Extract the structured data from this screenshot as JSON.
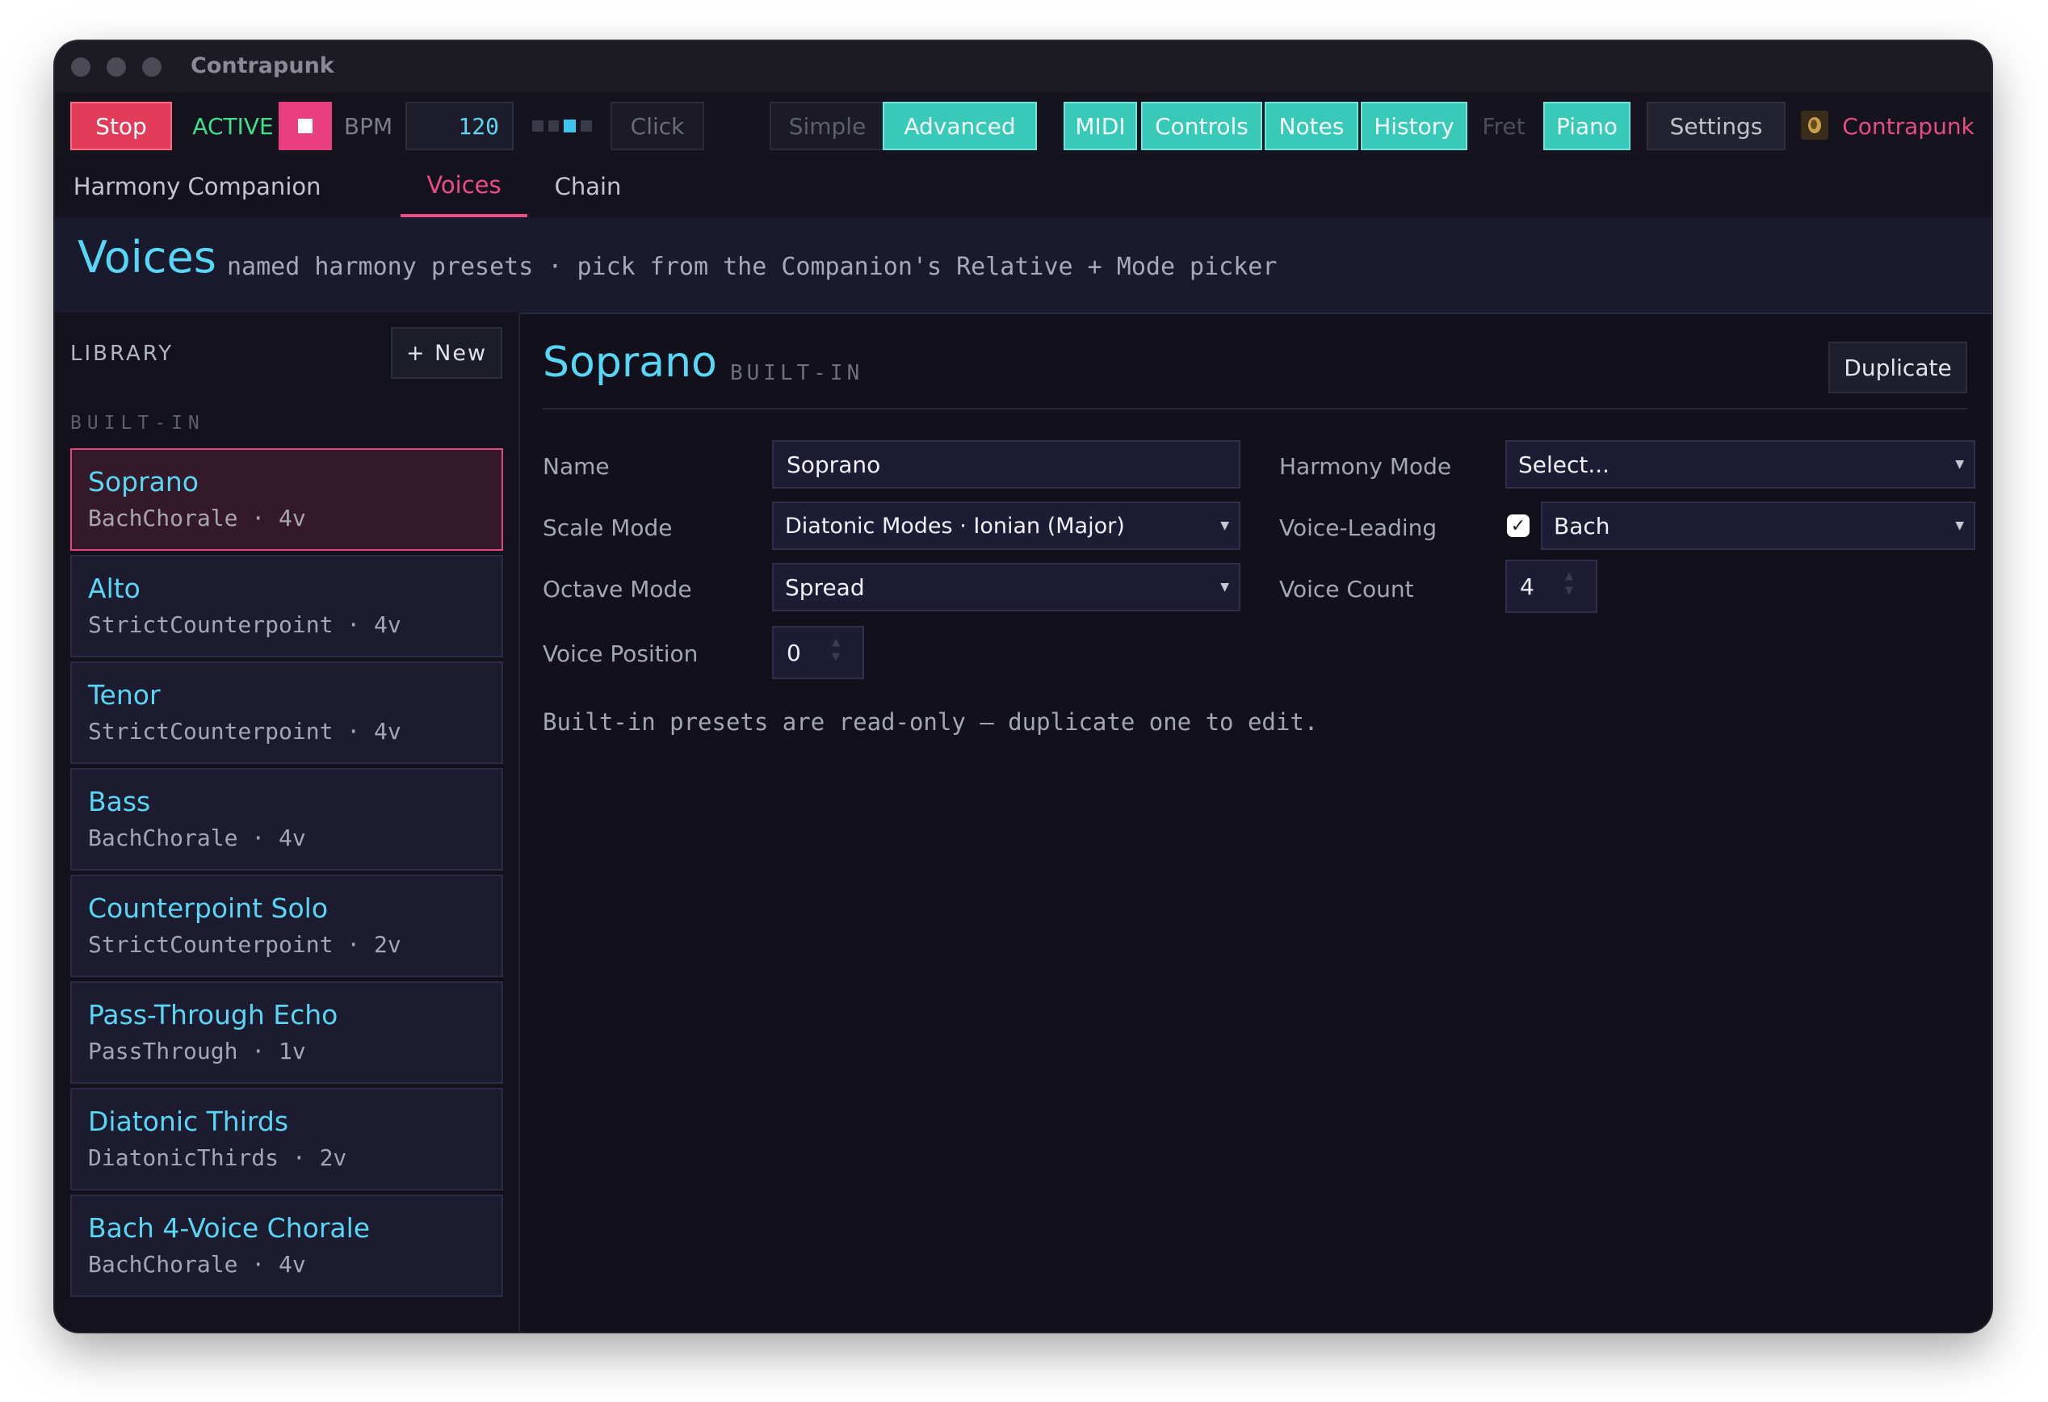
{
  "window": {
    "title": "Contrapunk"
  },
  "toolbar": {
    "stop": "Stop",
    "status": "ACTIVE",
    "bpm_label": "BPM",
    "bpm_value": "120",
    "click": "Click",
    "simple": "Simple",
    "advanced": "Advanced",
    "midi": "MIDI",
    "controls": "Controls",
    "notes": "Notes",
    "history": "History",
    "fret": "Fret",
    "piano": "Piano",
    "settings": "Settings",
    "brand": "Contrapunk"
  },
  "tabs": [
    {
      "label": "Harmony"
    },
    {
      "label": "Companion"
    },
    {
      "label": "Voices",
      "active": true
    },
    {
      "label": "Chain"
    }
  ],
  "header": {
    "title": "Voices",
    "subtitle": "named harmony presets · pick from the Companion's Relative + Mode picker"
  },
  "library": {
    "label": "LIBRARY",
    "new_button": "+ New",
    "group": "BUILT-IN",
    "items": [
      {
        "name": "Soprano",
        "meta": "BachChorale · 4v",
        "selected": true
      },
      {
        "name": "Alto",
        "meta": "StrictCounterpoint · 4v"
      },
      {
        "name": "Tenor",
        "meta": "StrictCounterpoint · 4v"
      },
      {
        "name": "Bass",
        "meta": "BachChorale · 4v"
      },
      {
        "name": "Counterpoint Solo",
        "meta": "StrictCounterpoint · 2v"
      },
      {
        "name": "Pass-Through Echo",
        "meta": "PassThrough · 1v"
      },
      {
        "name": "Diatonic Thirds",
        "meta": "DiatonicThirds · 2v"
      },
      {
        "name": "Bach 4-Voice Chorale",
        "meta": "BachChorale · 4v"
      }
    ]
  },
  "detail": {
    "title": "Soprano",
    "badge": "BUILT-IN",
    "duplicate": "Duplicate",
    "fields": {
      "name_label": "Name",
      "name_value": "Soprano",
      "scale_label": "Scale Mode",
      "scale_value": "Diatonic Modes · Ionian (Major)",
      "octave_label": "Octave Mode",
      "octave_value": "Spread",
      "position_label": "Voice Position",
      "position_value": "0",
      "harmony_label": "Harmony Mode",
      "harmony_value": "Select...",
      "leading_label": "Voice-Leading",
      "leading_checked": true,
      "leading_value": "Bach",
      "count_label": "Voice Count",
      "count_value": "4"
    },
    "note": "Built-in presets are read-only — duplicate one to edit."
  },
  "colors": {
    "accent_pink": "#ee4c87",
    "accent_cyan": "#58d6f5",
    "accent_teal": "#38c9b8",
    "active_green": "#3ee08b",
    "stop_red": "#e33b5a"
  }
}
